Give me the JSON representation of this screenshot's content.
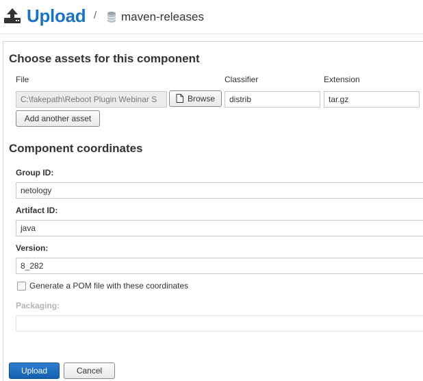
{
  "header": {
    "title": "Upload",
    "separator": "/",
    "repository": "maven-releases"
  },
  "assets": {
    "heading": "Choose assets for this component",
    "file_label": "File",
    "classifier_label": "Classifier",
    "extension_label": "Extension",
    "file_value": "C:\\fakepath\\Reboot Plugin Webinar S",
    "browse_label": "Browse",
    "classifier_value": "distrib",
    "extension_value": "tar.gz",
    "add_asset_label": "Add another asset"
  },
  "coordinates": {
    "heading": "Component coordinates",
    "group_label": "Group ID:",
    "group_value": "netology",
    "artifact_label": "Artifact ID:",
    "artifact_value": "java",
    "version_label": "Version:",
    "version_value": "8_282",
    "pom_label": "Generate a POM file with these coordinates",
    "pom_checked": false,
    "packaging_label": "Packaging:",
    "packaging_value": ""
  },
  "actions": {
    "upload_label": "Upload",
    "cancel_label": "Cancel"
  },
  "colors": {
    "accent": "#1a73c4",
    "primary_button": "#175fb0"
  }
}
